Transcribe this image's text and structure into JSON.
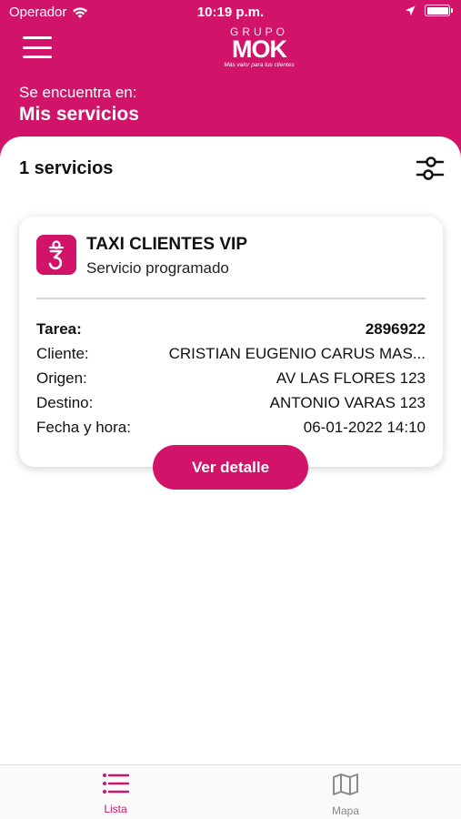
{
  "status_bar": {
    "carrier": "Operador",
    "time": "10:19 p.m."
  },
  "logo": {
    "top_text": "GRUPO",
    "main_text": "MOK",
    "tagline": "Más valor para tus clientes"
  },
  "header": {
    "location_label": "Se encuentra en:",
    "location_value": "Mis servicios"
  },
  "list": {
    "count_label": "1 servicios"
  },
  "service_card": {
    "title": "TAXI CLIENTES VIP",
    "subtitle": "Servicio programado",
    "rows": [
      {
        "label": "Tarea:",
        "value": "2896922"
      },
      {
        "label": "Cliente:",
        "value": "CRISTIAN EUGENIO CARUS MAS..."
      },
      {
        "label": "Origen:",
        "value": "AV LAS FLORES 123"
      },
      {
        "label": "Destino:",
        "value": "ANTONIO VARAS 123"
      },
      {
        "label": "Fecha y hora:",
        "value": "06-01-2022 14:10"
      }
    ],
    "button_label": "Ver detalle"
  },
  "tabbar": {
    "tabs": [
      {
        "label": "Lista",
        "icon": "list-icon",
        "active": true
      },
      {
        "label": "Mapa",
        "icon": "map-icon",
        "active": false
      }
    ]
  },
  "colors": {
    "brand": "#d2136a",
    "inactive_tab": "#8a8a8a"
  }
}
